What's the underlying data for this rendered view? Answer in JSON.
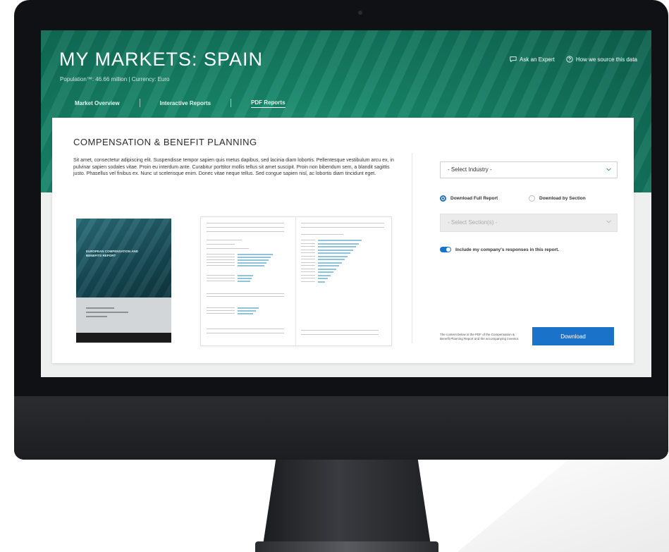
{
  "header": {
    "title": "MY MARKETS: SPAIN",
    "subtitle": "Population™: 46.66 million | Currency: Euro",
    "links": [
      {
        "label": "Ask an Expert"
      },
      {
        "label": "How we source this data"
      }
    ]
  },
  "nav": {
    "tabs": [
      {
        "label": "Market Overview"
      },
      {
        "label": "Interactive Reports"
      },
      {
        "label": "PDF Reports",
        "active": true
      }
    ]
  },
  "card": {
    "title": "COMPENSATION & BENEFIT PLANNING",
    "body": "Sit amet, consectetur adipiscing elit. Suspendisse tempor sapien quis metus dapibus, sed lacinia diam lobortis. Pellentesque vestibulum arcu ex, in pulvinar sapien sodales vitae. Proin eu interdum ante. Curabitur porttitor mollis tellus sit amet suscipit. Proin non bibendum sem, a blandit sagittis justo. Phasellus vel finibus ex. Nunc ut scelerisque enim. Donec vitae neque tellus. Sed congue sapien nisl, ac lobortis diam tincidunt eget.",
    "cover_text": "EUROPEAN COMPENSATION AND BENEFITS REPORT"
  },
  "panel": {
    "industry_select": "- Select Industry -",
    "radio_full": "Download Full Report",
    "radio_section": "Download by Section",
    "section_select": "- Select Section(s) -",
    "toggle_label": "Include my company's responses in this report.",
    "footnote": "The content below is the PDF of the Compensation & Benefit Planning Report and the accompanying inventor.",
    "download_label": "Download"
  },
  "colors": {
    "accent": "#1a73c8",
    "hero": "#17876a"
  },
  "icons": {
    "ask_expert": "chat-bubble-icon",
    "source": "help-circle-icon"
  }
}
